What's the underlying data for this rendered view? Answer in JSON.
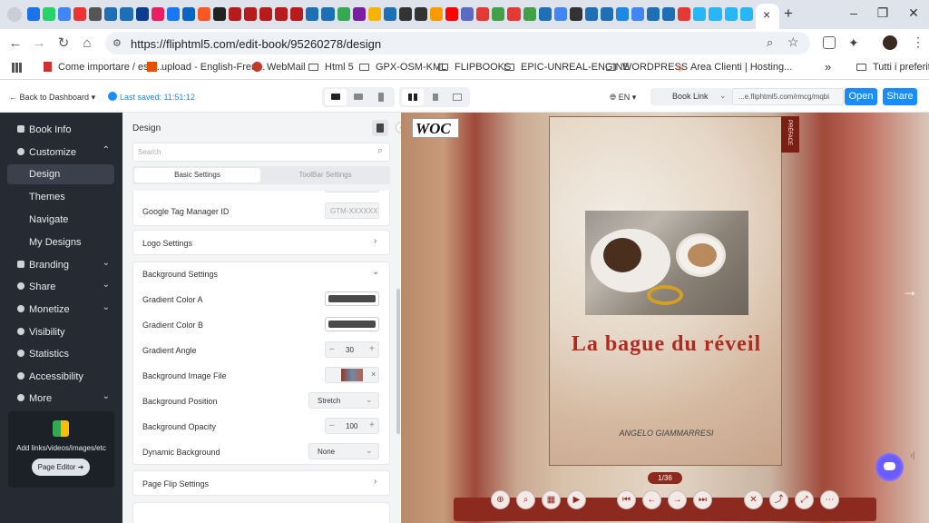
{
  "browser": {
    "url": "https://fliphtml5.com/edit-book/95260278/design",
    "bookmarks": [
      {
        "label": "Come importare / esp..."
      },
      {
        "label": "upload - English-Fren..."
      },
      {
        "label": "WebMail"
      },
      {
        "label": "Html 5"
      },
      {
        "label": "GPX-OSM-KML"
      },
      {
        "label": "FLIPBOOKS"
      },
      {
        "label": "EPIC-UNREAL-ENGINE"
      },
      {
        "label": "WORDPRESS"
      },
      {
        "label": "Area Clienti | Hosting..."
      }
    ],
    "bookmarks_more": "»",
    "bookmarks_all": "Tutti i preferiti",
    "new_tab": "+",
    "tab_close": "×",
    "win_min": "–",
    "win_max": "❐",
    "win_close": "✕"
  },
  "header": {
    "back_label": "Back to Dashboard",
    "saved_label": "Last saved: 11:51:12",
    "lang": "EN",
    "book_link_label": "Book Link",
    "link_value": "...e.fliphtml5.com/rmcg/mqbi",
    "open_label": "Open",
    "share_label": "Share"
  },
  "sidebar": {
    "items": [
      {
        "label": "Book Info"
      },
      {
        "label": "Customize"
      },
      {
        "label": "Design"
      },
      {
        "label": "Themes"
      },
      {
        "label": "Navigate"
      },
      {
        "label": "My Designs"
      },
      {
        "label": "Branding"
      },
      {
        "label": "Share"
      },
      {
        "label": "Monetize"
      },
      {
        "label": "Visibility"
      },
      {
        "label": "Statistics"
      },
      {
        "label": "Accessibility"
      },
      {
        "label": "More"
      }
    ],
    "promo_text": "Add links/videos/images/etc",
    "promo_button": "Page Editor ➜"
  },
  "panel": {
    "title": "Design",
    "search_placeholder": "Search",
    "tabs": [
      "Basic Settings",
      "ToolBar Settings"
    ],
    "gtm_label": "Google Tag Manager ID",
    "gtm_placeholder": "GTM-XXXXXX",
    "logo_settings": "Logo Settings",
    "background_settings": "Background Settings",
    "gradient_a": "Gradient Color A",
    "gradient_b": "Gradient Color B",
    "gradient_angle": "Gradient Angle",
    "gradient_angle_value": "30",
    "bg_image_file": "Background Image File",
    "bg_position": "Background Position",
    "bg_position_value": "Stretch",
    "bg_opacity": "Background Opacity",
    "bg_opacity_value": "100",
    "dynamic_bg": "Dynamic Background",
    "dynamic_bg_value": "None",
    "page_flip_settings": "Page Flip Settings"
  },
  "preview": {
    "logo_text": "WOC",
    "tab_label": "PRÉFACE",
    "book_title": "La bague du réveil",
    "author": "ANGELO GIAMMARRESI",
    "pager": "1/36"
  }
}
